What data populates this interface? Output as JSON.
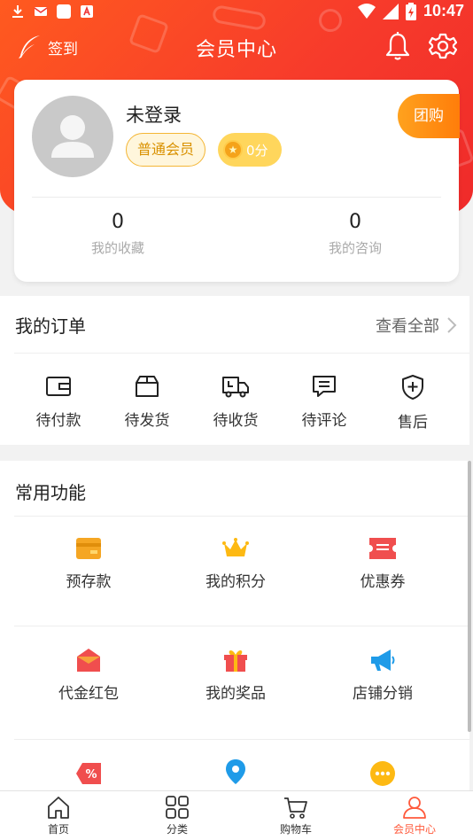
{
  "status_bar": {
    "time": "10:47"
  },
  "header": {
    "signin_label": "签到",
    "title": "会员中心"
  },
  "profile": {
    "username": "未登录",
    "member_level": "普通会员",
    "points": "0分",
    "group_buy_label": "团购",
    "stats": [
      {
        "value": "0",
        "label": "我的收藏"
      },
      {
        "value": "0",
        "label": "我的咨询"
      }
    ]
  },
  "orders": {
    "title": "我的订单",
    "view_all": "查看全部",
    "items": [
      {
        "label": "待付款",
        "icon": "wallet-icon"
      },
      {
        "label": "待发货",
        "icon": "box-icon"
      },
      {
        "label": "待收货",
        "icon": "truck-icon"
      },
      {
        "label": "待评论",
        "icon": "comment-icon"
      },
      {
        "label": "售后",
        "icon": "shield-plus-icon"
      }
    ]
  },
  "functions": {
    "title": "常用功能",
    "items": [
      {
        "label": "预存款",
        "icon": "card-icon"
      },
      {
        "label": "我的积分",
        "icon": "crown-icon"
      },
      {
        "label": "优惠券",
        "icon": "ticket-icon"
      },
      {
        "label": "代金红包",
        "icon": "red-envelope-icon"
      },
      {
        "label": "我的奖品",
        "icon": "gift-icon"
      },
      {
        "label": "店铺分销",
        "icon": "megaphone-icon"
      },
      {
        "label": "",
        "icon": "discount-tag-icon"
      },
      {
        "label": "",
        "icon": "location-pin-icon"
      },
      {
        "label": "",
        "icon": "more-dots-icon"
      }
    ]
  },
  "bottom_nav": [
    {
      "label": "首页",
      "icon": "home-icon"
    },
    {
      "label": "分类",
      "icon": "grid-icon"
    },
    {
      "label": "购物车",
      "icon": "cart-icon"
    },
    {
      "label": "会员中心",
      "icon": "user-icon",
      "active": true
    }
  ],
  "colors": {
    "brand_red": "#f73b2b",
    "brand_orange": "#ff5a1f",
    "active_nav": "#ff5a3c",
    "member_badge": "#d99100"
  }
}
